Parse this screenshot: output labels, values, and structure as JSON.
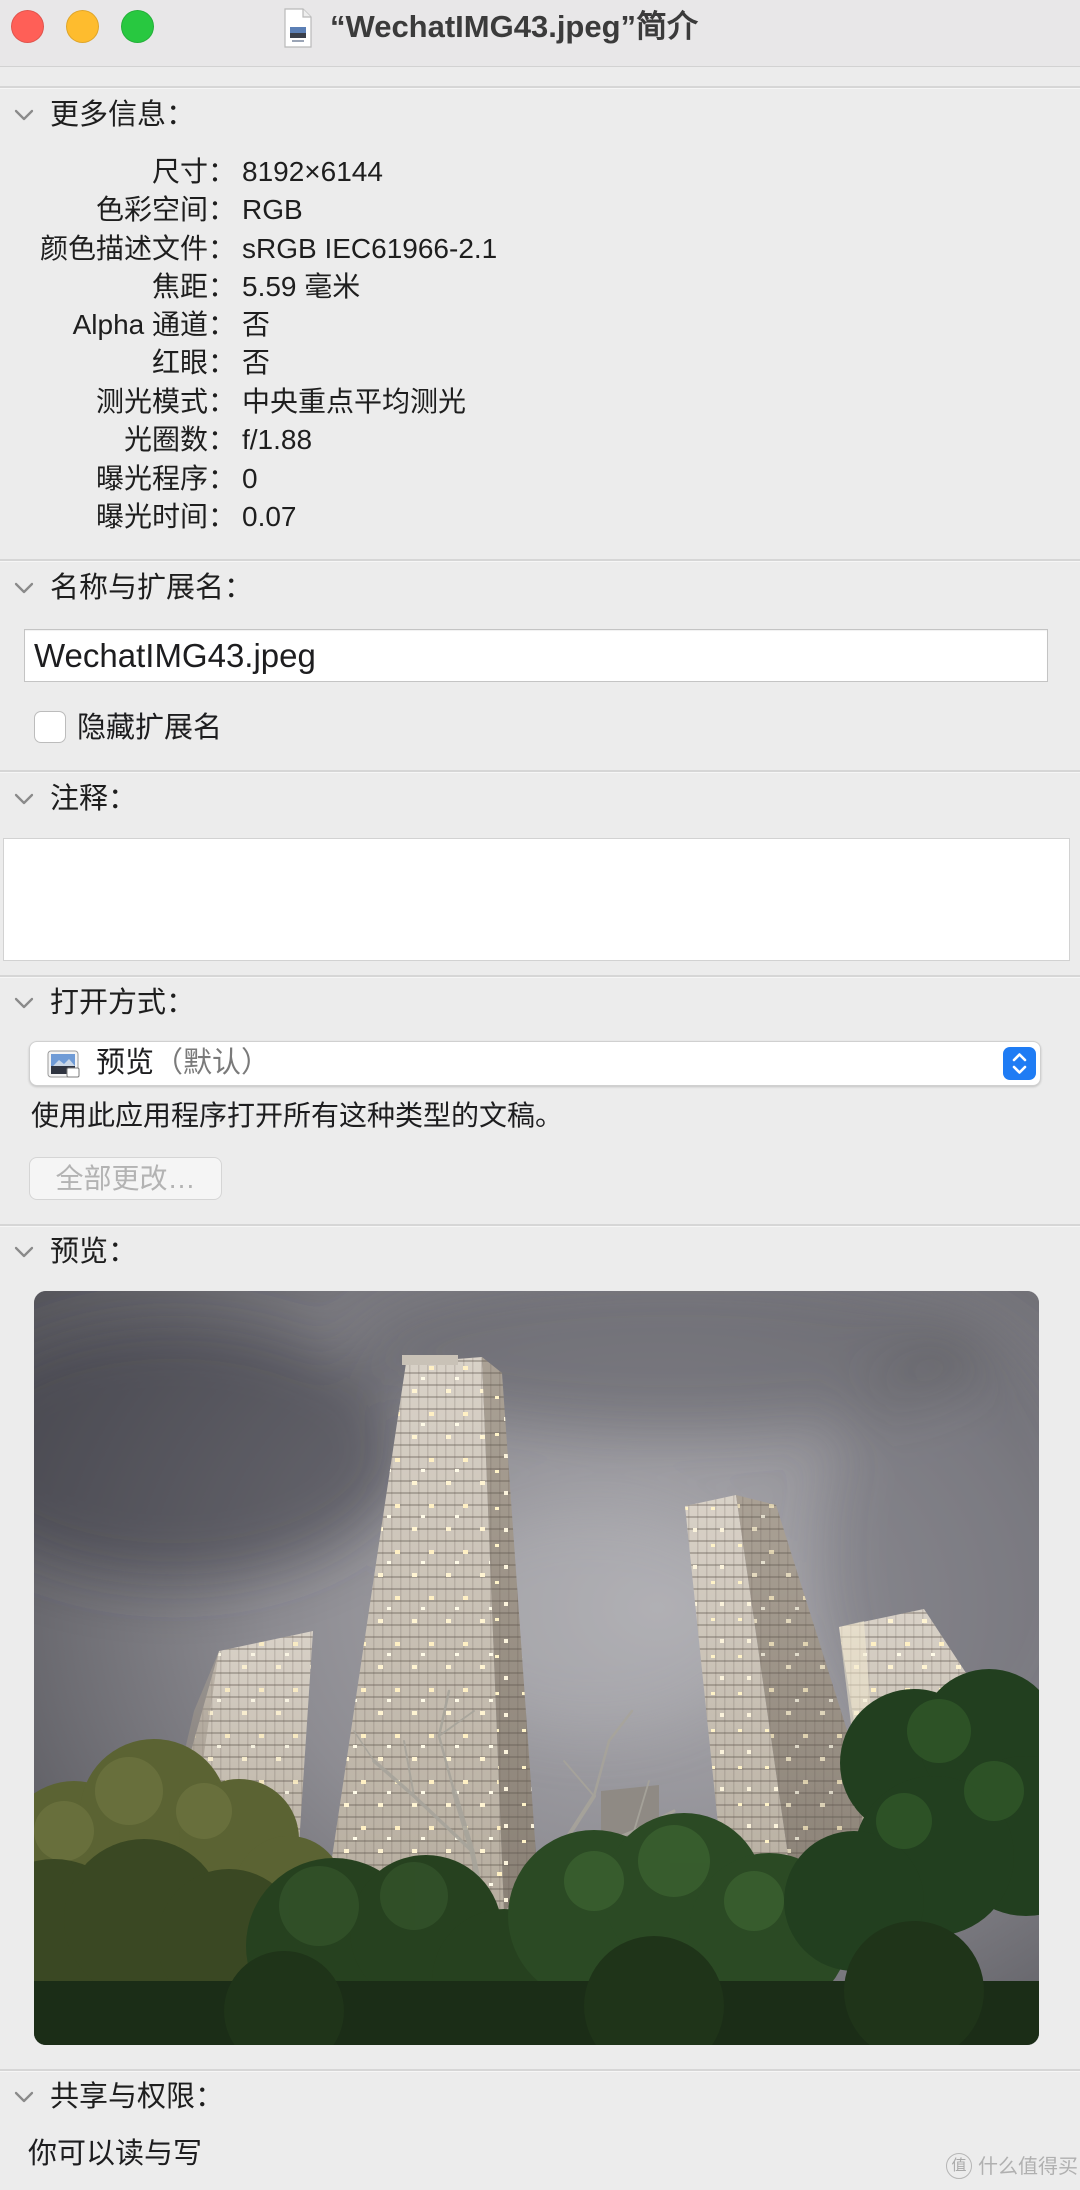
{
  "window": {
    "title": "“WechatIMG43.jpeg”简介",
    "title_icon": "jpeg-file-icon"
  },
  "controls": {
    "close_color": "#ff5f57",
    "minimize_color": "#febc2e",
    "zoom_color": "#28c840"
  },
  "more_info": {
    "header": "更多信息：",
    "rows": [
      {
        "label": "尺寸：",
        "value": "8192×6144"
      },
      {
        "label": "色彩空间：",
        "value": "RGB"
      },
      {
        "label": "颜色描述文件：",
        "value": "sRGB IEC61966-2.1"
      },
      {
        "label": "焦距：",
        "value": "5.59 毫米"
      },
      {
        "label": "Alpha 通道：",
        "value": "否"
      },
      {
        "label": "红眼：",
        "value": "否"
      },
      {
        "label": "测光模式：",
        "value": "中央重点平均测光"
      },
      {
        "label": "光圈数：",
        "value": "f/1.88"
      },
      {
        "label": "曝光程序：",
        "value": "0"
      },
      {
        "label": "曝光时间：",
        "value": "0.07"
      }
    ]
  },
  "name_extension": {
    "header": "名称与扩展名：",
    "filename": "WechatIMG43.jpeg",
    "hide_extension_label": "隐藏扩展名",
    "hide_extension_checked": false
  },
  "comments": {
    "header": "注释：",
    "text": ""
  },
  "open_with": {
    "header": "打开方式：",
    "app_name": "预览",
    "app_suffix": "（默认）",
    "app_icon": "preview-app-icon",
    "description": "使用此应用程序打开所有这种类型的文稿。",
    "change_all_label": "全部更改…",
    "change_all_enabled": false
  },
  "preview": {
    "header": "预览："
  },
  "sharing": {
    "header": "共享与权限：",
    "status": "你可以读与写"
  },
  "watermark": {
    "badge": "值",
    "text": "什么值得买"
  },
  "colors": {
    "background": "#ececec",
    "accent": "#1f7cf4",
    "divider": "#d6d6d6"
  }
}
